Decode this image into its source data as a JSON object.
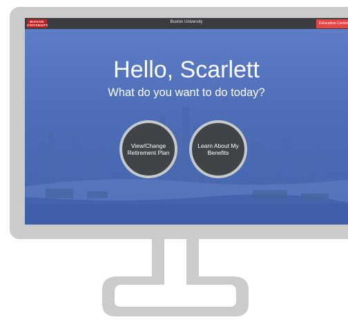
{
  "header": {
    "logo_line1": "BOSTON",
    "logo_line2": "UNIVERSITY",
    "title": "Boston University",
    "education_center_label": "Education Center"
  },
  "main": {
    "greeting": "Hello, Scarlett",
    "question": "What do you want to do today?",
    "actions": [
      {
        "label": "View/Change\nRetirement Plan"
      },
      {
        "label": "Learn About My\nBenefits"
      }
    ]
  },
  "colors": {
    "bezel": "#cbcbcc",
    "topbar": "#3a3c40",
    "accent_red": "#e84545",
    "screen_blue": "#4f6fb5",
    "button_dark": "#3f4448"
  }
}
